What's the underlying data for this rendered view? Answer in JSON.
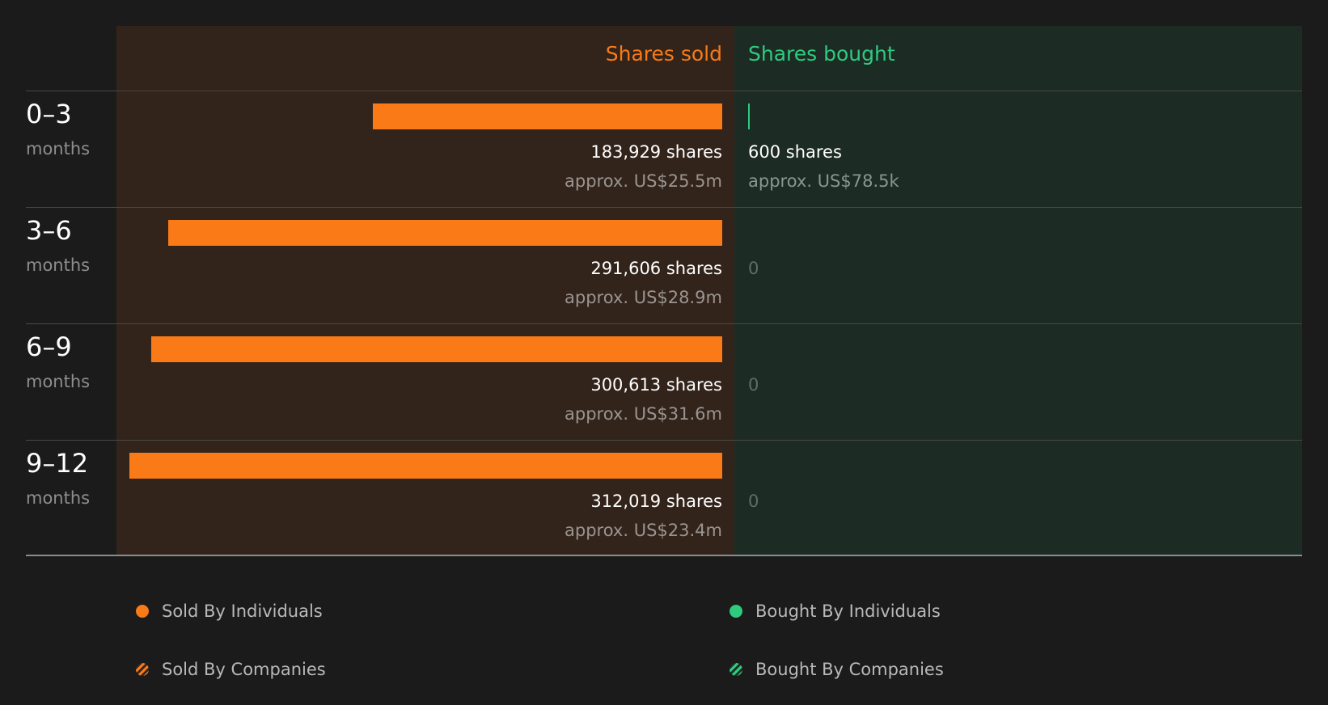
{
  "chart_data": {
    "type": "bar",
    "headers": {
      "sold": "Shares sold",
      "bought": "Shares bought"
    },
    "periods": [
      {
        "range": "0–3",
        "unit": "months",
        "sold_shares": 183929,
        "sold_shares_label": "183,929 shares",
        "sold_value_label": "approx. US$25.5m",
        "bought_shares": 600,
        "bought_label": "600 shares",
        "bought_value_label": "approx. US$78.5k"
      },
      {
        "range": "3–6",
        "unit": "months",
        "sold_shares": 291606,
        "sold_shares_label": "291,606 shares",
        "sold_value_label": "approx. US$28.9m",
        "bought_shares": 0,
        "bought_label": "0",
        "bought_value_label": ""
      },
      {
        "range": "6–9",
        "unit": "months",
        "sold_shares": 300613,
        "sold_shares_label": "300,613 shares",
        "sold_value_label": "approx. US$31.6m",
        "bought_shares": 0,
        "bought_label": "0",
        "bought_value_label": ""
      },
      {
        "range": "9–12",
        "unit": "months",
        "sold_shares": 312019,
        "sold_shares_label": "312,019 shares",
        "sold_value_label": "approx. US$23.4m",
        "bought_shares": 0,
        "bought_label": "0",
        "bought_value_label": ""
      }
    ],
    "legend": [
      {
        "label": "Sold By Individuals",
        "color": "#f97a17",
        "pattern": "solid"
      },
      {
        "label": "Bought By Individuals",
        "color": "#2ecb7f",
        "pattern": "solid"
      },
      {
        "label": "Sold By Companies",
        "color": "#f97a17",
        "pattern": "hatched"
      },
      {
        "label": "Bought By Companies",
        "color": "#2ecb7f",
        "pattern": "hatched"
      }
    ],
    "colors": {
      "sold": "#f97a17",
      "bought": "#2ecb7f"
    }
  }
}
